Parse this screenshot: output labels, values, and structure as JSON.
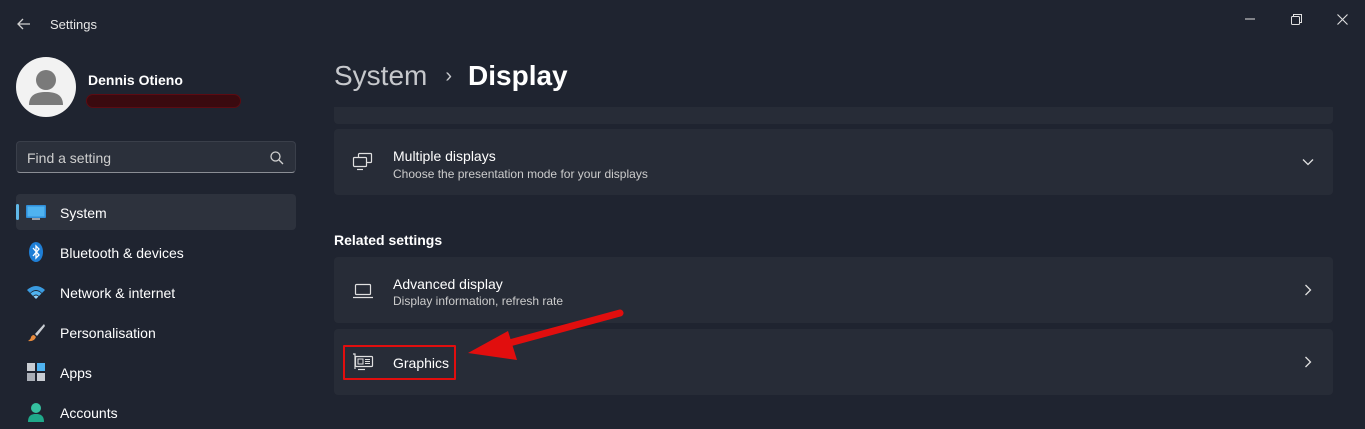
{
  "window": {
    "app_title": "Settings",
    "controls": {
      "minimize": "minimize-icon",
      "maximize": "maximize-icon",
      "close": "close-icon"
    }
  },
  "profile": {
    "name": "Dennis Otieno",
    "email_redacted": true
  },
  "search": {
    "placeholder": "Find a setting"
  },
  "sidebar": {
    "items": [
      {
        "label": "System",
        "icon": "monitor-icon",
        "active": true
      },
      {
        "label": "Bluetooth & devices",
        "icon": "bluetooth-icon"
      },
      {
        "label": "Network & internet",
        "icon": "wifi-icon"
      },
      {
        "label": "Personalisation",
        "icon": "paintbrush-icon"
      },
      {
        "label": "Apps",
        "icon": "apps-icon"
      },
      {
        "label": "Accounts",
        "icon": "person-icon"
      }
    ]
  },
  "breadcrumb": {
    "parent": "System",
    "separator": "›",
    "current": "Display"
  },
  "cards": {
    "multiple_displays": {
      "title": "Multiple displays",
      "subtitle": "Choose the presentation mode for your displays"
    },
    "related_heading": "Related settings",
    "advanced_display": {
      "title": "Advanced display",
      "subtitle": "Display information, refresh rate"
    },
    "graphics": {
      "title": "Graphics"
    }
  },
  "colors": {
    "background": "#1f2430",
    "card": "#272c37",
    "accent": "#60b8e8",
    "annotation_red": "#e10e0e"
  }
}
